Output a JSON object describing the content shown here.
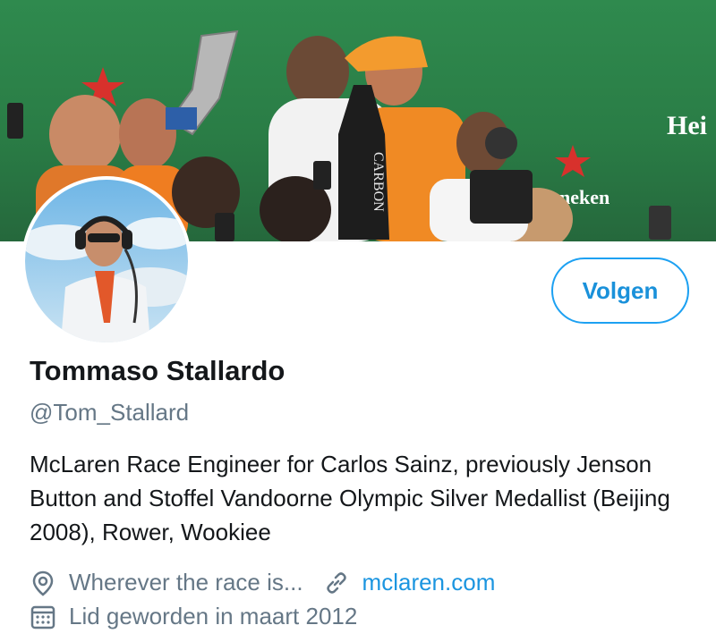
{
  "profile": {
    "name": "Tommaso Stallardo",
    "handle": "@Tom_Stallard",
    "bio": "McLaren Race Engineer for Carlos Sainz, previously Jenson Button and Stoffel Vandoorne Olympic Silver Medallist (Beijing 2008), Rower, Wookiee",
    "location": "Wherever the race is...",
    "website": "mclaren.com",
    "joined": "Lid geworden in maart 2012"
  },
  "actions": {
    "follow_label": "Volgen"
  },
  "banner": {
    "sponsor_text_1": "Hei",
    "sponsor_text_2": "neken",
    "bottle_text": "CARBON"
  },
  "icons": {
    "location": "map-pin-icon",
    "website": "link-icon",
    "joined": "calendar-icon"
  },
  "colors": {
    "accent": "#1da1f2",
    "link": "#1b95e0",
    "secondary_text": "#657786",
    "primary_text": "#14171a",
    "banner_green": "#2f8a4e"
  }
}
